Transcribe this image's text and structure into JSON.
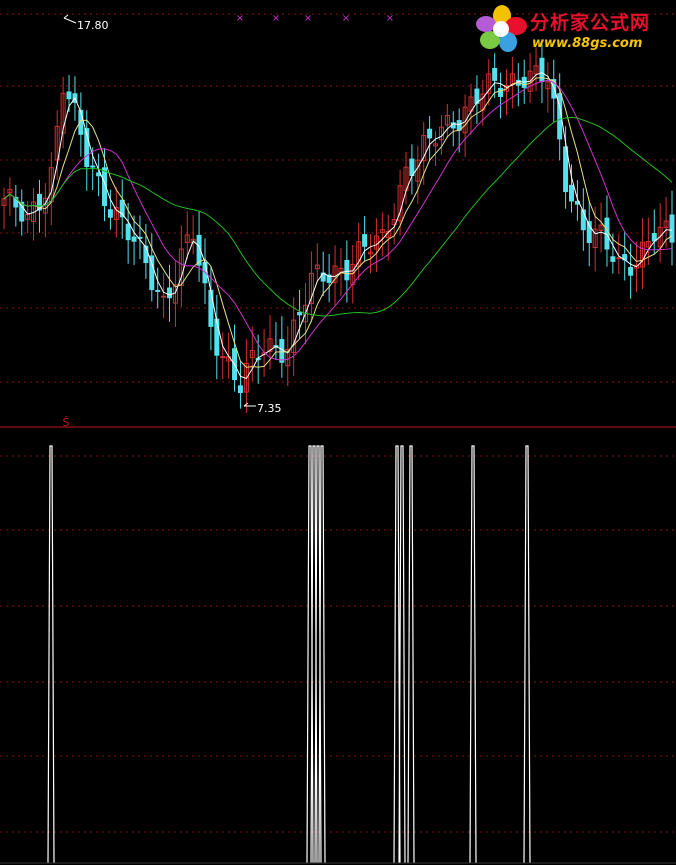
{
  "logo": {
    "title": "分析家公式网",
    "url": "www.88gs.com"
  },
  "colors": {
    "background": "#000000",
    "grid": "#8a1010",
    "divider": "#c01818",
    "up_candle": "#d03030",
    "down_candle": "#54e0ec",
    "ma_short": "#ffffff",
    "ma_mid": "#e6e08a",
    "ma_long": "#cc33cc",
    "ma_longest": "#22bb22",
    "signal": "#ffffff",
    "marker": "#cc33cc"
  },
  "chart_data": [
    {
      "type": "candlestick",
      "title": "",
      "annotations": [
        {
          "text": "17.80",
          "kind": "high",
          "candle_index": 10
        },
        {
          "text": "7.35",
          "kind": "low",
          "candle_index": 39
        }
      ],
      "price_range": [
        7.0,
        19.2
      ],
      "grid": true,
      "top_markers": {
        "symbol": "×",
        "count": 5
      },
      "divider_symbol": "Ŝ",
      "series": [
        {
          "name": "",
          "role": "ma_short"
        },
        {
          "name": "",
          "role": "ma_mid"
        },
        {
          "name": "",
          "role": "ma_long"
        },
        {
          "name": "",
          "role": "ma_longest"
        }
      ]
    },
    {
      "type": "bar",
      "title": "",
      "signal_positions": [
        51,
        310,
        314,
        318,
        322,
        397,
        402,
        411,
        473,
        527
      ],
      "values": [
        1,
        1,
        1,
        1,
        1,
        1,
        1,
        1,
        1,
        1
      ],
      "grid": true
    }
  ]
}
